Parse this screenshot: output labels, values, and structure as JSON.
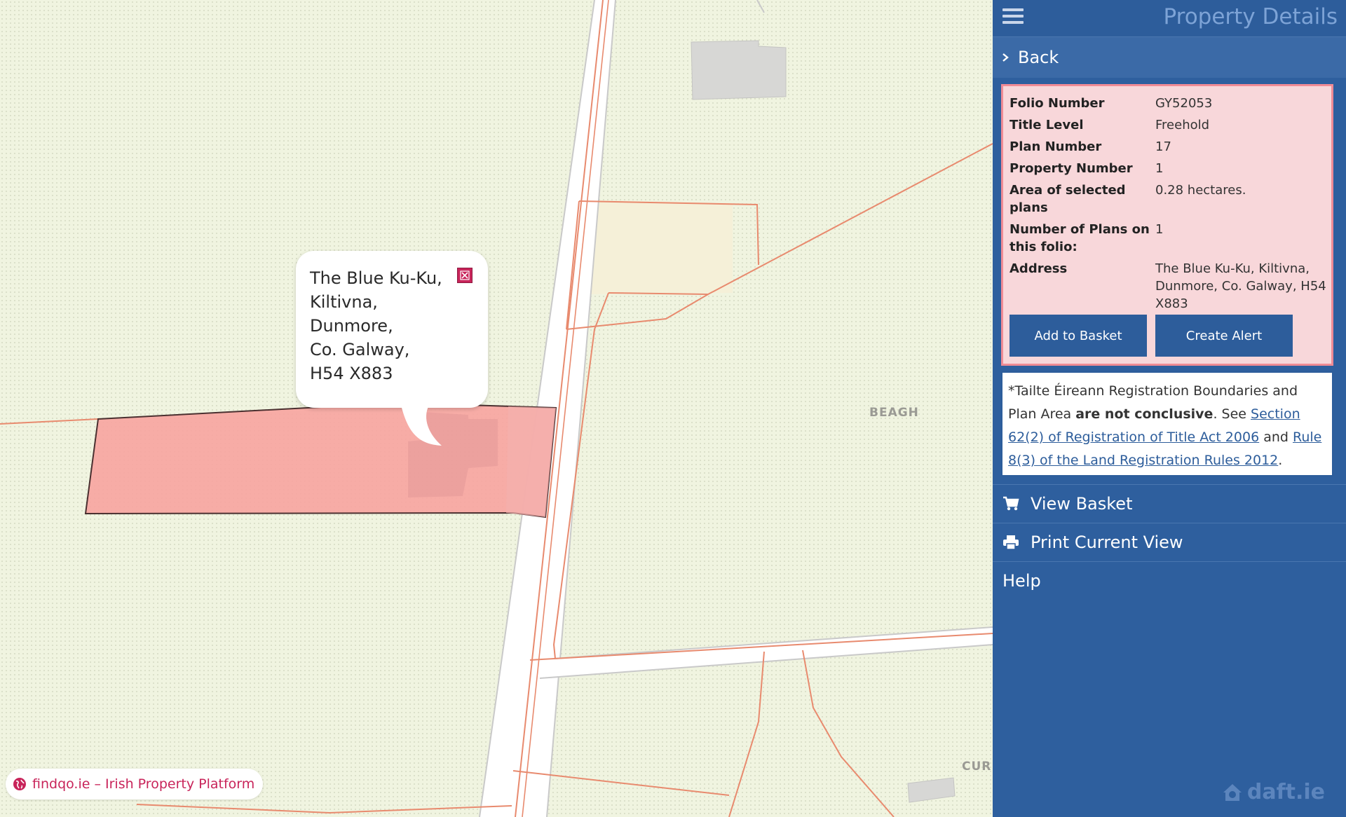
{
  "map": {
    "labels": {
      "beagh": "BEAGH",
      "cur": "CUR"
    },
    "popup": {
      "address_lines": [
        "The Blue Ku-Ku,",
        "Kiltivna,",
        "Dunmore,",
        "Co. Galway,",
        "H54 X883"
      ]
    },
    "brand_pill": {
      "icon": "globe-icon",
      "text": "findqo.ie – Irish Property Platform"
    }
  },
  "panel": {
    "title": "Property Details",
    "menu_icon": "hamburger-icon",
    "back": {
      "icon": "chevron-right-icon",
      "label": "Back"
    },
    "details": [
      {
        "key": "Folio Number",
        "value": "GY52053"
      },
      {
        "key": "Title Level",
        "value": "Freehold"
      },
      {
        "key": "Plan Number",
        "value": "17"
      },
      {
        "key": "Property Number",
        "value": "1"
      },
      {
        "key": "Area of selected plans",
        "value": "0.28 hectares."
      },
      {
        "key": "Number of Plans on this folio:",
        "value": "1"
      },
      {
        "key": "Address",
        "value": "The Blue Ku-Ku, Kiltivna, Dunmore, Co. Galway, H54 X883"
      }
    ],
    "buttons": {
      "add_to_basket": "Add to Basket",
      "create_alert": "Create Alert"
    },
    "disclaimer": {
      "intro": "*Tailte Éireann Registration Boundaries and Plan Area ",
      "bold": "are not conclusive",
      "see": ". See ",
      "link1": "Section 62(2) of Registration of Title Act 2006",
      "and": " and ",
      "link2": "Rule 8(3) of the Land Registration Rules 2012",
      "end": "."
    },
    "menu": [
      {
        "icon": "cart-icon",
        "label": "View Basket"
      },
      {
        "icon": "printer-icon",
        "label": "Print Current View"
      },
      {
        "icon": "",
        "label": "Help"
      }
    ],
    "watermark": "daft.ie"
  },
  "colors": {
    "panel_blue": "#2e5f9e",
    "card_pink": "#f8d7da",
    "parcel_fill": "#f7a5a1",
    "road_line": "#e88a6e",
    "brand_pink": "#c8245a"
  }
}
